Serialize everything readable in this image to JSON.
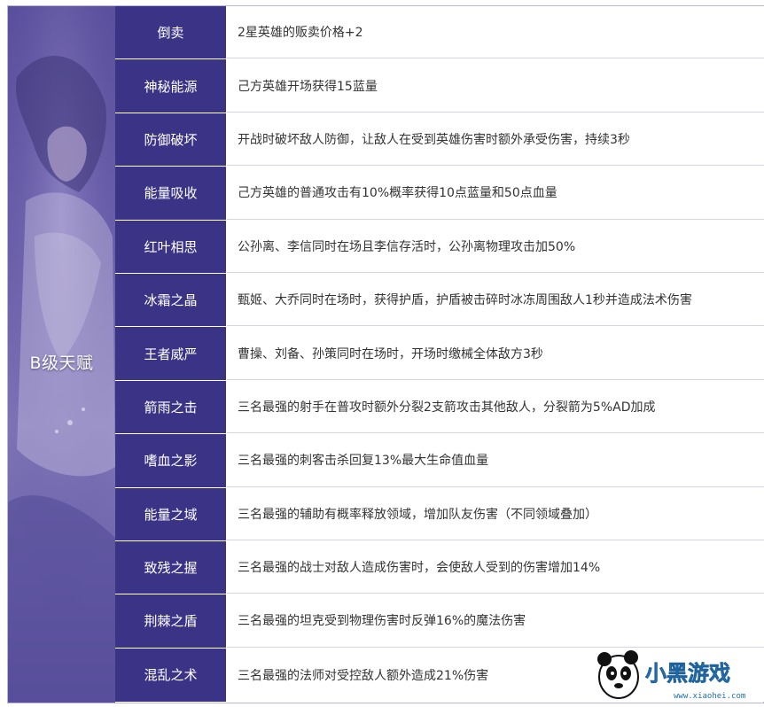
{
  "tier": {
    "label": "B级天赋"
  },
  "talents": [
    {
      "name": "倒卖",
      "desc": "2星英雄的贩卖价格+2"
    },
    {
      "name": "神秘能源",
      "desc": "己方英雄开场获得15蓝量"
    },
    {
      "name": "防御破坏",
      "desc": "开战时破坏敌人防御，让敌人在受到英雄伤害时额外承受伤害，持续3秒"
    },
    {
      "name": "能量吸收",
      "desc": "己方英雄的普通攻击有10%概率获得10点蓝量和50点血量"
    },
    {
      "name": "红叶相思",
      "desc": "公孙离、李信同时在场且李信存活时，公孙离物理攻击加50%"
    },
    {
      "name": "冰霜之晶",
      "desc": "甄姬、大乔同时在场时，获得护盾，护盾被击碎时冰冻周围敌人1秒并造成法术伤害"
    },
    {
      "name": "王者威严",
      "desc": "曹操、刘备、孙策同时在场时，开场时缴械全体敌方3秒"
    },
    {
      "name": "箭雨之击",
      "desc": "三名最强的射手在普攻时额外分裂2支箭攻击其他敌人，分裂箭为5%AD加成"
    },
    {
      "name": "嗜血之影",
      "desc": "三名最强的刺客击杀回复13%最大生命值血量"
    },
    {
      "name": "能量之域",
      "desc": "三名最强的辅助有概率释放领域，增加队友伤害（不同领域叠加）"
    },
    {
      "name": "致残之握",
      "desc": "三名最强的战士对敌人造成伤害时，会使敌人受到的伤害增加14%"
    },
    {
      "name": "荆棘之盾",
      "desc": "三名最强的坦克受到物理伤害时反弹16%的魔法伤害"
    },
    {
      "name": "混乱之术",
      "desc": "三名最强的法师对受控敌人额外造成21%伤害"
    }
  ],
  "watermark": {
    "brand": "小黑游戏",
    "url": "www.xiaohei.com"
  },
  "colors": {
    "name_cell_bg": "#3b3386",
    "tier_cell_bg": "#6a5faa",
    "desc_text": "#333333",
    "border": "#d6d4e6"
  }
}
